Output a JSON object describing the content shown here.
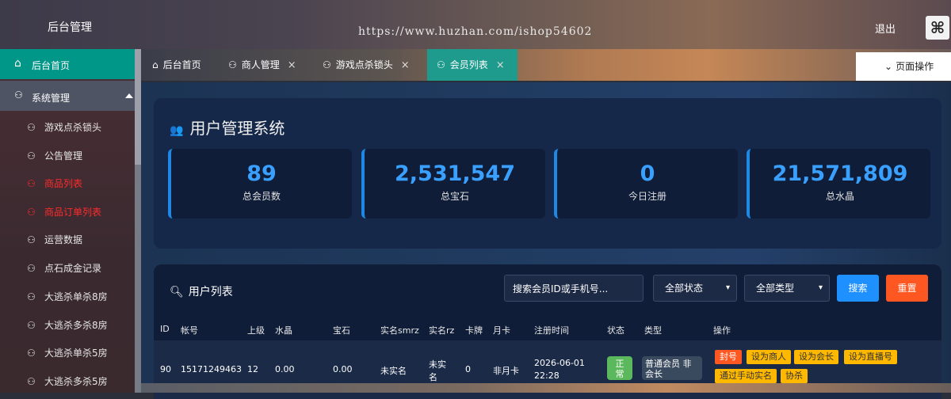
{
  "header": {
    "title": "后台管理",
    "watermark": "https://www.huzhan.com/ishop54602",
    "logout": "退出"
  },
  "sidebar": {
    "home": "后台首页",
    "system": "系统管理",
    "items": [
      {
        "label": "游戏点杀锁头"
      },
      {
        "label": "公告管理"
      },
      {
        "label": "商品列表"
      },
      {
        "label": "商品订单列表"
      },
      {
        "label": "运营数据"
      },
      {
        "label": "点石成金记录"
      },
      {
        "label": "大逃杀单杀8房"
      },
      {
        "label": "大逃杀多杀8房"
      },
      {
        "label": "大逃杀单杀5房"
      },
      {
        "label": "大逃杀多杀5房"
      }
    ]
  },
  "tabs": [
    {
      "label": "后台首页"
    },
    {
      "label": "商人管理"
    },
    {
      "label": "游戏点杀锁头"
    },
    {
      "label": "会员列表"
    }
  ],
  "tab_close": "×",
  "page_ops": "页面操作",
  "dashboard": {
    "title": "用户管理系统",
    "stats": [
      {
        "value": "89",
        "label": "总会员数"
      },
      {
        "value": "2,531,547",
        "label": "总宝石"
      },
      {
        "value": "0",
        "label": "今日注册"
      },
      {
        "value": "21,571,809",
        "label": "总水晶"
      }
    ]
  },
  "user_list": {
    "title": "用户列表",
    "search_placeholder": "搜索会员ID或手机号...",
    "status_select": "全部状态",
    "type_select": "全部类型",
    "search_btn": "搜索",
    "reset_btn": "重置",
    "columns": [
      "ID",
      "帐号",
      "上级",
      "水晶",
      "宝石",
      "实名smrz",
      "实名rz",
      "卡牌",
      "月卡",
      "注册时间",
      "状态",
      "类型",
      "操作"
    ],
    "row": {
      "id": "90",
      "account": "15171249463",
      "parent": "12",
      "crystal": "0.00",
      "gem": "0.00",
      "smrz": "未实名",
      "rz_line1": "未实",
      "rz_line2": "名",
      "card": "0",
      "month": "非月卡",
      "reg_date": "2026-06-01",
      "reg_time": "22:28",
      "status_line1": "正",
      "status_line2": "常",
      "type_line1": "普通会员 非",
      "type_line2": "会长",
      "ops": [
        "封号",
        "设为商人",
        "设为会长",
        "设为直播号",
        "通过手动实名",
        "协杀"
      ]
    }
  }
}
